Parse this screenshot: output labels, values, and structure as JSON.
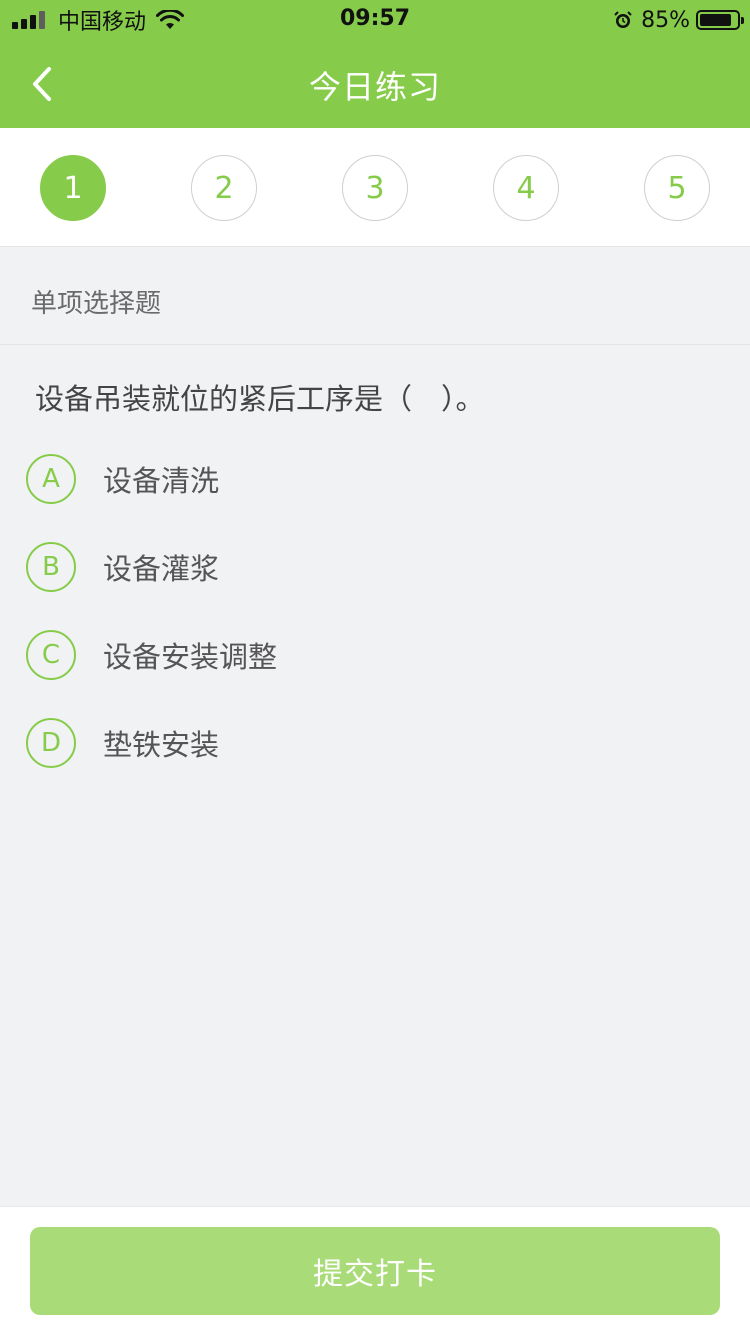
{
  "status_bar": {
    "carrier": "中国移动",
    "time": "09:57",
    "battery_percent": "85%",
    "battery_level": 0.85
  },
  "nav": {
    "title": "今日练习",
    "back_icon": "chevron-left-icon"
  },
  "steps": [
    {
      "label": "1",
      "active": true
    },
    {
      "label": "2",
      "active": false
    },
    {
      "label": "3",
      "active": false
    },
    {
      "label": "4",
      "active": false
    },
    {
      "label": "5",
      "active": false
    }
  ],
  "section": {
    "title": "单项选择题"
  },
  "question": {
    "text": "设备吊装就位的紧后工序是（　）。",
    "options": [
      {
        "letter": "A",
        "text": "设备清洗"
      },
      {
        "letter": "B",
        "text": "设备灌浆"
      },
      {
        "letter": "C",
        "text": "设备安装调整"
      },
      {
        "letter": "D",
        "text": "垫铁安装"
      }
    ]
  },
  "footer": {
    "submit_label": "提交打卡"
  },
  "colors": {
    "accent": "#86cc4a",
    "submit_disabled": "#a9dc78",
    "background": "#f1f2f4"
  }
}
